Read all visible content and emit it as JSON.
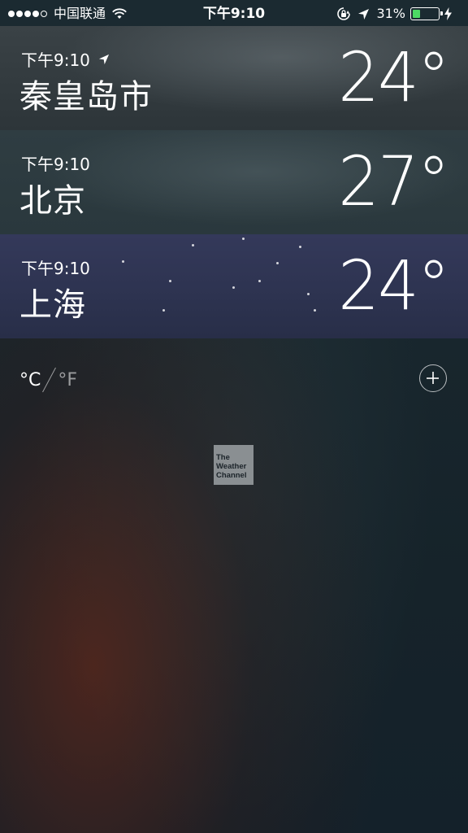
{
  "status_bar": {
    "carrier": "中国联通",
    "time": "下午9:10",
    "battery_percent": "31%",
    "battery_level": 0.31,
    "signal_bars_filled": 4,
    "signal_bars_total": 5
  },
  "cities": [
    {
      "time": "下午9:10",
      "name": "秦皇岛市",
      "temp": "24°",
      "is_current_location": true
    },
    {
      "time": "下午9:10",
      "name": "北京",
      "temp": "27°",
      "is_current_location": false
    },
    {
      "time": "下午9:10",
      "name": "上海",
      "temp": "24°",
      "is_current_location": false
    }
  ],
  "units": {
    "celsius": "°C",
    "fahrenheit": "°F",
    "selected": "celsius"
  },
  "logo": {
    "line1": "The",
    "line2": "Weather",
    "line3": "Channel"
  },
  "colors": {
    "battery": "#4cd964",
    "shanghai_row": "#2d3350"
  }
}
